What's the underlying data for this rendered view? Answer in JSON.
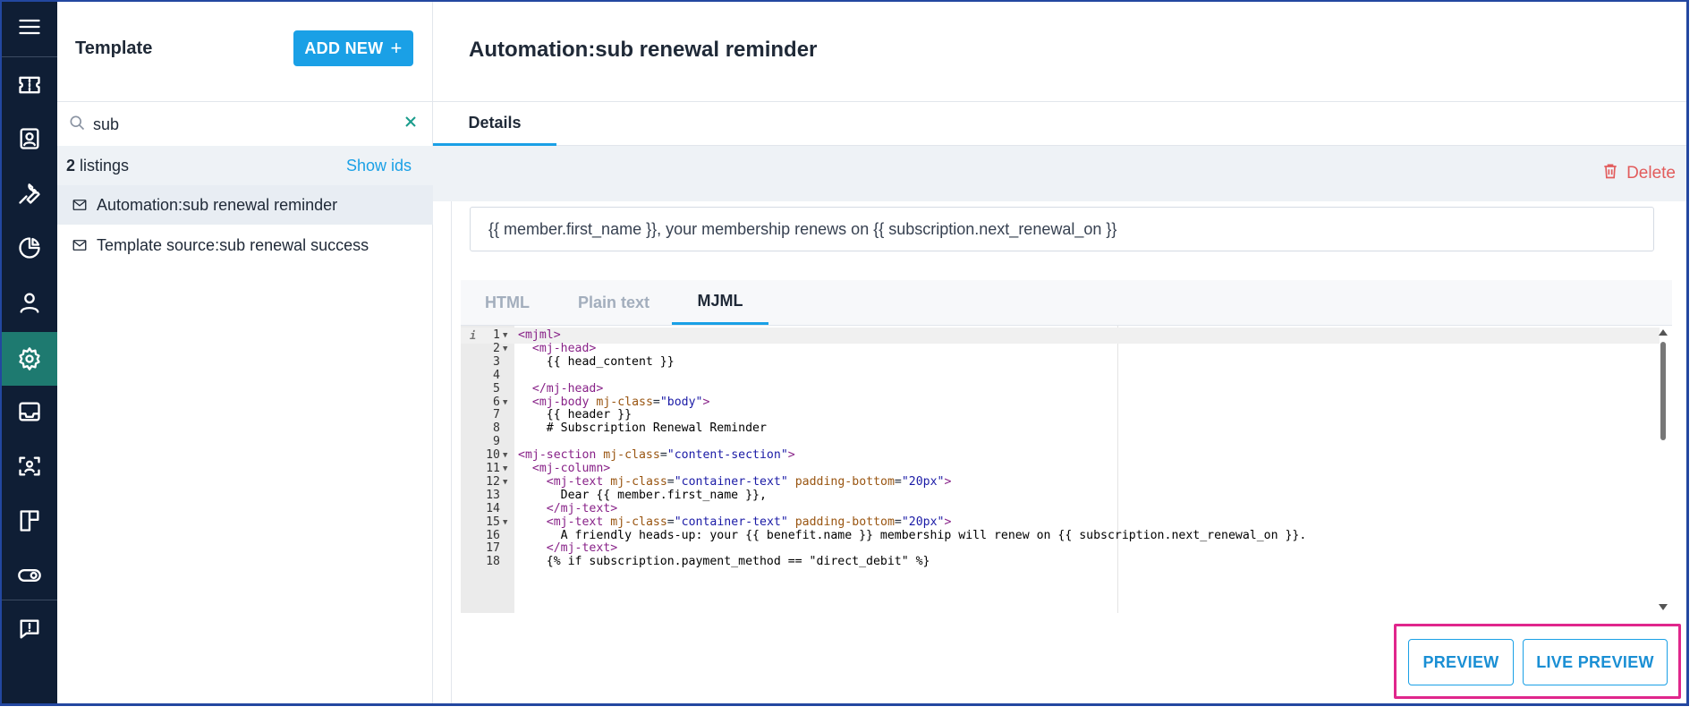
{
  "sidebar": {
    "icons": [
      "menu-icon",
      "ticket-icon",
      "contact-card-icon",
      "wrench-icon",
      "pie-chart-icon",
      "user-icon",
      "settings-gear-icon",
      "inbox-icon",
      "face-scan-icon",
      "layout-board-icon",
      "toggle-icon",
      "feedback-message-icon"
    ],
    "active_icon": "settings-gear-icon"
  },
  "list_panel": {
    "title": "Template",
    "add_button_label": "ADD NEW",
    "add_button_icon": "+",
    "search": {
      "value": "sub",
      "placeholder": ""
    },
    "listing_count": "2",
    "listing_count_label": "listings",
    "show_ids_label": "Show ids",
    "items": [
      {
        "label": "Automation:sub renewal reminder",
        "selected": true
      },
      {
        "label": "Template source:sub renewal success",
        "selected": false
      }
    ]
  },
  "main": {
    "title": "Automation:sub renewal reminder",
    "tabs": [
      {
        "label": "Details",
        "active": true
      }
    ],
    "delete_label": "Delete",
    "subject_value": "{{ member.first_name }}, your membership renews on {{ subscription.next_renewal_on }}",
    "editor_tabs": [
      {
        "label": "HTML",
        "active": false
      },
      {
        "label": "Plain text",
        "active": false
      },
      {
        "label": "MJML",
        "active": true
      }
    ],
    "code_lines": [
      {
        "n": "1",
        "fold": true,
        "text": "<mjml>"
      },
      {
        "n": "2",
        "fold": true,
        "text": "  <mj-head>"
      },
      {
        "n": "3",
        "fold": false,
        "text": "    {{ head_content }}"
      },
      {
        "n": "4",
        "fold": false,
        "text": ""
      },
      {
        "n": "5",
        "fold": false,
        "text": "  </mj-head>"
      },
      {
        "n": "6",
        "fold": true,
        "text": "  <mj-body mj-class=\"body\">"
      },
      {
        "n": "7",
        "fold": false,
        "text": "    {{ header }}"
      },
      {
        "n": "8",
        "fold": false,
        "text": "    # Subscription Renewal Reminder"
      },
      {
        "n": "9",
        "fold": false,
        "text": ""
      },
      {
        "n": "10",
        "fold": true,
        "text": "<mj-section mj-class=\"content-section\">"
      },
      {
        "n": "11",
        "fold": true,
        "text": "  <mj-column>"
      },
      {
        "n": "12",
        "fold": true,
        "text": "    <mj-text mj-class=\"container-text\" padding-bottom=\"20px\">"
      },
      {
        "n": "13",
        "fold": false,
        "text": "      Dear {{ member.first_name }},"
      },
      {
        "n": "14",
        "fold": false,
        "text": "    </mj-text>"
      },
      {
        "n": "15",
        "fold": true,
        "text": "    <mj-text mj-class=\"container-text\" padding-bottom=\"20px\">"
      },
      {
        "n": "16",
        "fold": false,
        "text": "      A friendly heads-up: your {{ benefit.name }} membership will renew on {{ subscription.next_renewal_on }}."
      },
      {
        "n": "17",
        "fold": false,
        "text": "    </mj-text>"
      },
      {
        "n": "18",
        "fold": false,
        "text": "    {% if subscription.payment_method == \"direct_debit\" %}"
      }
    ],
    "preview_label": "PREVIEW",
    "live_preview_label": "LIVE PREVIEW"
  },
  "colors": {
    "rail_bg": "#0f1e35",
    "rail_active": "#1e7a70",
    "accent": "#1aa0e6",
    "delete": "#e25c5c",
    "highlight": "#e0268c"
  }
}
